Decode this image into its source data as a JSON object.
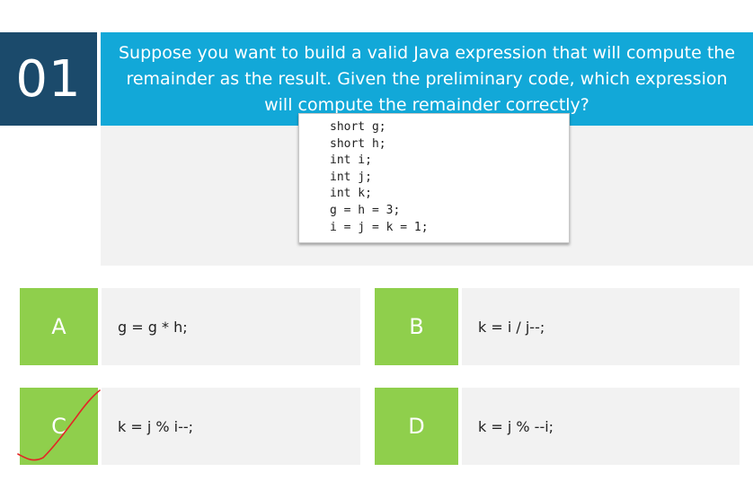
{
  "question": {
    "number": "01",
    "prompt": "Suppose you want to build a valid Java expression that will compute the remainder as the result. Given the preliminary code, which expression will compute the remainder correctly?",
    "code_lines": [
      "short g;",
      "short h;",
      "int i;",
      "int j;",
      "int k;",
      "g = h = 3;",
      "i = j = k = 1;"
    ]
  },
  "options": [
    {
      "letter": "A",
      "text": "g = g * h;"
    },
    {
      "letter": "B",
      "text": "k = i / j--;"
    },
    {
      "letter": "C",
      "text": "k = j % i--;"
    },
    {
      "letter": "D",
      "text": "k = j % --i;"
    }
  ],
  "colors": {
    "number_box": "#1b4a6b",
    "header": "#12a8d8",
    "option_letter": "#8fcf4c",
    "option_bg": "#f2f2f2",
    "check_mark": "#e32626"
  }
}
